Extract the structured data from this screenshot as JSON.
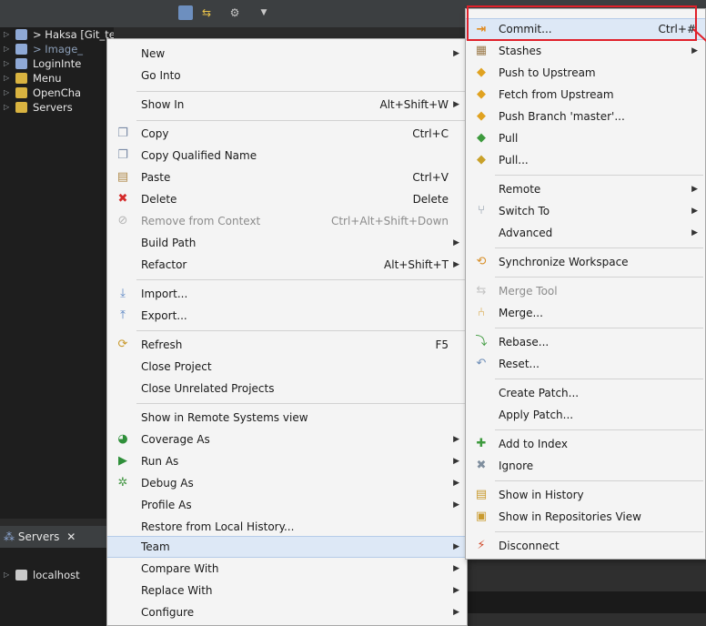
{
  "colors": {
    "menu_bg": "#f4f4f4",
    "hover": "#dde8f6",
    "annotation": "#e0202a",
    "tree_bg": "#1e1e1e"
  },
  "project_tree": [
    {
      "label": "> Haksa [Git_test master]",
      "icon": "git-project-icon",
      "selected": true
    },
    {
      "label": "> Image_",
      "icon": "git-project-icon",
      "selected": false
    },
    {
      "label": "LoginInte",
      "icon": "java-project-icon",
      "selected": false
    },
    {
      "label": "Menu",
      "icon": "folder-icon",
      "selected": false
    },
    {
      "label": "OpenCha",
      "icon": "folder-icon",
      "selected": false
    },
    {
      "label": "Servers",
      "icon": "folder-icon",
      "selected": false
    }
  ],
  "servers_view": {
    "tab_label": "Servers",
    "close": "✕",
    "node": "localhost"
  },
  "context_menu": {
    "items": [
      {
        "label": "New",
        "submenu": true
      },
      {
        "label": "Go Into"
      },
      {
        "label": "Show In",
        "shortcut": "Alt+Shift+W",
        "submenu": true
      },
      {
        "label": "Copy",
        "shortcut": "Ctrl+C",
        "icon": "copy-icon"
      },
      {
        "label": "Copy Qualified Name",
        "icon": "copy-qualified-name-icon"
      },
      {
        "label": "Paste",
        "shortcut": "Ctrl+V",
        "icon": "paste-icon"
      },
      {
        "label": "Delete",
        "shortcut": "Delete",
        "icon": "delete-icon"
      },
      {
        "label": "Remove from Context",
        "shortcut": "Ctrl+Alt+Shift+Down",
        "icon": "remove-context-icon",
        "disabled": true
      },
      {
        "label": "Build Path",
        "submenu": true
      },
      {
        "label": "Refactor",
        "shortcut": "Alt+Shift+T",
        "submenu": true
      },
      {
        "label": "Import...",
        "icon": "import-icon"
      },
      {
        "label": "Export...",
        "icon": "export-icon"
      },
      {
        "label": "Refresh",
        "shortcut": "F5",
        "icon": "refresh-icon"
      },
      {
        "label": "Close Project"
      },
      {
        "label": "Close Unrelated Projects"
      },
      {
        "label": "Show in Remote Systems view"
      },
      {
        "label": "Coverage As",
        "icon": "coverage-icon",
        "submenu": true
      },
      {
        "label": "Run As",
        "icon": "run-icon",
        "submenu": true
      },
      {
        "label": "Debug As",
        "icon": "debug-icon",
        "submenu": true
      },
      {
        "label": "Profile As",
        "submenu": true
      },
      {
        "label": "Restore from Local History..."
      },
      {
        "label": "Team",
        "submenu": true,
        "hover": true
      },
      {
        "label": "Compare With",
        "submenu": true
      },
      {
        "label": "Replace With",
        "submenu": true
      },
      {
        "label": "Configure",
        "submenu": true
      }
    ]
  },
  "team_menu": {
    "items": [
      {
        "label": "Commit...",
        "shortcut": "Ctrl+#",
        "icon": "commit-icon",
        "hover": true
      },
      {
        "label": "Stashes",
        "icon": "stashes-icon",
        "submenu": true
      },
      {
        "label": "Push to Upstream",
        "icon": "push-upstream-icon"
      },
      {
        "label": "Fetch from Upstream",
        "icon": "fetch-upstream-icon"
      },
      {
        "label": "Push Branch 'master'...",
        "icon": "push-branch-icon"
      },
      {
        "label": "Pull",
        "icon": "pull-icon"
      },
      {
        "label": "Pull...",
        "icon": "pull-dialog-icon"
      },
      {
        "label": "Remote",
        "submenu": true
      },
      {
        "label": "Switch To",
        "icon": "switch-to-icon",
        "submenu": true
      },
      {
        "label": "Advanced",
        "submenu": true
      },
      {
        "label": "Synchronize Workspace",
        "icon": "synchronize-icon"
      },
      {
        "label": "Merge Tool",
        "icon": "merge-tool-icon",
        "disabled": true
      },
      {
        "label": "Merge...",
        "icon": "merge-icon"
      },
      {
        "label": "Rebase...",
        "icon": "rebase-icon"
      },
      {
        "label": "Reset...",
        "icon": "reset-icon"
      },
      {
        "label": "Create Patch..."
      },
      {
        "label": "Apply Patch..."
      },
      {
        "label": "Add to Index",
        "icon": "add-to-index-icon"
      },
      {
        "label": "Ignore",
        "icon": "ignore-icon"
      },
      {
        "label": "Show in History",
        "icon": "history-icon"
      },
      {
        "label": "Show in Repositories View",
        "icon": "repositories-icon"
      },
      {
        "label": "Disconnect",
        "icon": "disconnect-icon"
      }
    ]
  }
}
